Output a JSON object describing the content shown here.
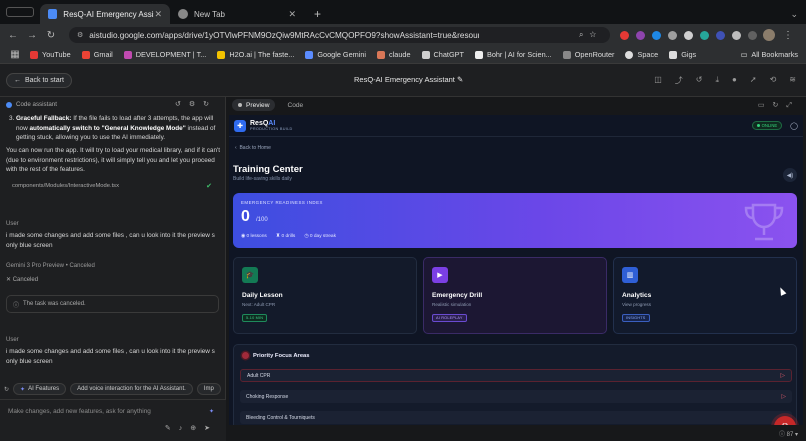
{
  "browser": {
    "tabs": [
      {
        "label": "ResQ-AI Emergency Assistant",
        "active": true
      },
      {
        "label": "New Tab",
        "active": false
      }
    ],
    "url": "aistudio.google.com/apps/drive/1yOTVlwPFNM9OzQiw9MtRAcCvCMQOPFO9?showAssistant=true&resourceKey=...",
    "bookmarks": [
      "YouTube",
      "Gmail",
      "DEVELOPMENT | T...",
      "H2O.ai | The faste...",
      "Google Gemini",
      "claude",
      "ChatGPT",
      "Bohr | AI for Scien...",
      "OpenRouter",
      "Space",
      "Gigs"
    ],
    "all_bookmarks": "All Bookmarks",
    "zoom": "87"
  },
  "header": {
    "back": "Back to start",
    "title": "ResQ-AI Emergency Assistant"
  },
  "left": {
    "section": "Code assistant",
    "para1_bold": "Graceful Fallback:",
    "para1_a": " If the file fails to load after 3 attempts, the app will now ",
    "para1_b": "automatically switch to \"General Knowledge Mode\"",
    "para1_c": " instead of getting stuck, allowing you to use the AI immediately.",
    "para1_num": "3.",
    "para2": "You can now run the app. It will try to load your medical library, and if it can't (due to environment restrictions), it will simply tell you and let you proceed with the rest of the features.",
    "file": "components/Modules/InteractiveMode.tsx",
    "user1_label": "User",
    "user1_text": "i made some changes and add some files , can u look into it the preview s only blue screen",
    "model_label": "Gemini 3 Pro Preview",
    "model_status": "Canceled",
    "canceled": "Canceled",
    "canceled_box": "The task was canceled.",
    "user2_label": "User",
    "user2_text": "i made some changes and add some files , can u look into it the preview s only blue screen",
    "chips": [
      "AI Features",
      "Add voice interaction for the AI Assistant.",
      "Imp"
    ],
    "composer_placeholder": "Make changes, add new features, ask for anything"
  },
  "preview": {
    "tab_preview": "Preview",
    "tab_code": "Code",
    "brand_a": "ResQ",
    "brand_b": "AI",
    "brand_sub": "PRODUCTION BUILD",
    "online": "ONLINE",
    "back_home": "Back to Home",
    "title": "Training Center",
    "subtitle": "Build life-saving skills daily",
    "ready_label": "EMERGENCY READINESS INDEX",
    "ready_value": "0",
    "ready_max": "/100",
    "stats": [
      "0 lessons",
      "0 drills",
      "0 day streak"
    ],
    "cards": [
      {
        "title": "Daily Lesson",
        "sub": "Next: Adult CPR",
        "tag": "5-10 MIN"
      },
      {
        "title": "Emergency Drill",
        "sub": "Realistic simulation",
        "tag": "AI ROLEPLAY"
      },
      {
        "title": "Analytics",
        "sub": "View progress",
        "tag": "INSIGHTS"
      }
    ],
    "priority_title": "Priority Focus Areas",
    "priority_items": [
      "Adult CPR",
      "Choking Response",
      "Bleeding Control & Tourniquets"
    ],
    "colors": {
      "accent": "#4c5be6",
      "danger": "#c62828",
      "online": "#34d17a"
    }
  }
}
